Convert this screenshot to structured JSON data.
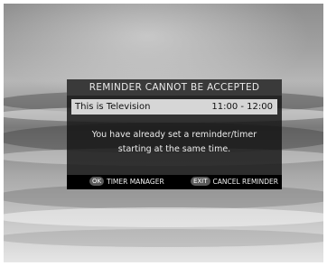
{
  "dialog": {
    "title": "REMINDER CANNOT BE ACCEPTED",
    "program": {
      "name": "This is Television",
      "time": "11:00 - 12:00"
    },
    "message_lines": [
      "You have already set a reminder/timer",
      "starting at the same time."
    ],
    "footer": {
      "ok_key": "OK",
      "ok_label": "TIMER MANAGER",
      "exit_key": "EXIT",
      "exit_label": "CANCEL REMINDER"
    }
  },
  "colors": {
    "dialog_background": "#121212",
    "title_bar": "#3a3a3a",
    "program_row": "#d6d6d6",
    "footer_bar": "#000000",
    "key_badge": "#5a5a5a"
  }
}
